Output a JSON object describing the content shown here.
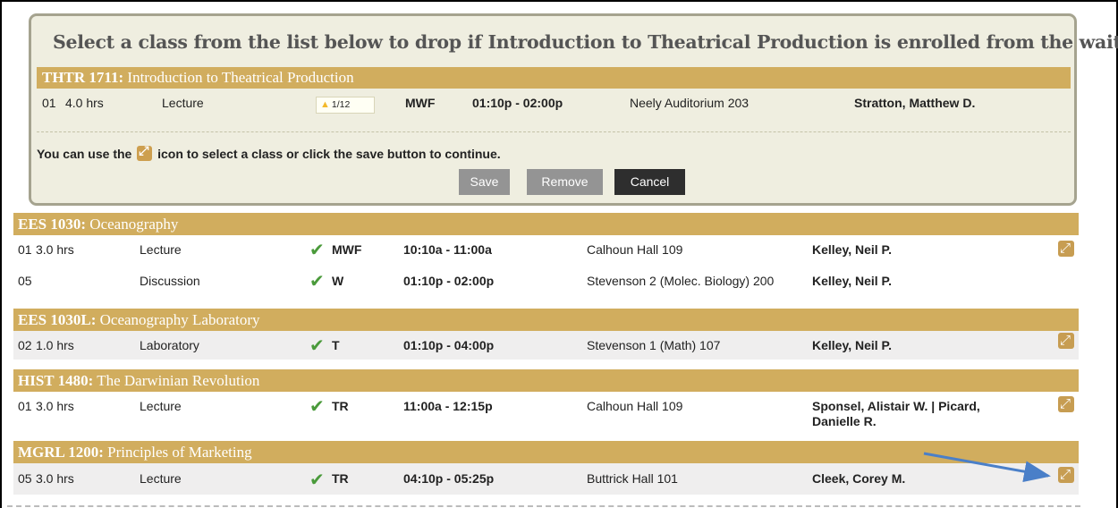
{
  "dialog": {
    "title": "Select a class from the list below to drop if Introduction to Theatrical Production is enrolled from the wait list.",
    "course_code": "THTR 1711:",
    "course_name": " Introduction to Theatrical Production",
    "section": {
      "number": "01",
      "hours": "4.0 hrs",
      "type": "Lecture",
      "waitlist": "1/12",
      "days": "MWF",
      "time": "01:10p - 02:00p",
      "location": "Neely Auditorium 203",
      "instructor": "Stratton, Matthew D."
    },
    "instruction_pre": "You can use the ",
    "instruction_post": " icon to select a class or click the save button to continue.",
    "buttons": {
      "save": "Save",
      "remove": "Remove",
      "cancel": "Cancel"
    }
  },
  "courses": [
    {
      "code": "EES 1030:",
      "name": " Oceanography",
      "sections": [
        {
          "number": "01",
          "hours": "3.0 hrs",
          "type": "Lecture",
          "days": "MWF",
          "time": "10:10a - 11:00a",
          "location": "Calhoun Hall 109",
          "instructor": "Kelley, Neil P."
        },
        {
          "number": "05",
          "hours": "",
          "type": "Discussion",
          "days": "W",
          "time": "01:10p - 02:00p",
          "location": "Stevenson 2 (Molec. Biology) 200",
          "instructor": "Kelley, Neil P."
        }
      ]
    },
    {
      "code": "EES 1030L:",
      "name": " Oceanography Laboratory",
      "sections": [
        {
          "number": "02",
          "hours": "1.0 hrs",
          "type": "Laboratory",
          "days": "T",
          "time": "01:10p - 04:00p",
          "location": "Stevenson 1 (Math) 107",
          "instructor": "Kelley, Neil P."
        }
      ]
    },
    {
      "code": "HIST 1480:",
      "name": " The Darwinian Revolution",
      "sections": [
        {
          "number": "01",
          "hours": "3.0 hrs",
          "type": "Lecture",
          "days": "TR",
          "time": "11:00a - 12:15p",
          "location": "Calhoun Hall 109",
          "instructor": "Sponsel, Alistair W. | Picard, Danielle R."
        }
      ]
    },
    {
      "code": "MGRL 1200:",
      "name": " Principles of Marketing",
      "sections": [
        {
          "number": "05",
          "hours": "3.0 hrs",
          "type": "Lecture",
          "days": "TR",
          "time": "04:10p - 05:25p",
          "location": "Buttrick Hall 101",
          "instructor": "Cleek, Corey M."
        }
      ]
    }
  ],
  "icons": {
    "enrolled_check": "check-icon",
    "swap": "swap-icon",
    "warning": "warning-icon"
  },
  "colors": {
    "course_header": "#d1ad5e",
    "dialog_bg": "#efeee0",
    "check": "#4a9a3b",
    "annotation_arrow": "#4a7fc8"
  }
}
